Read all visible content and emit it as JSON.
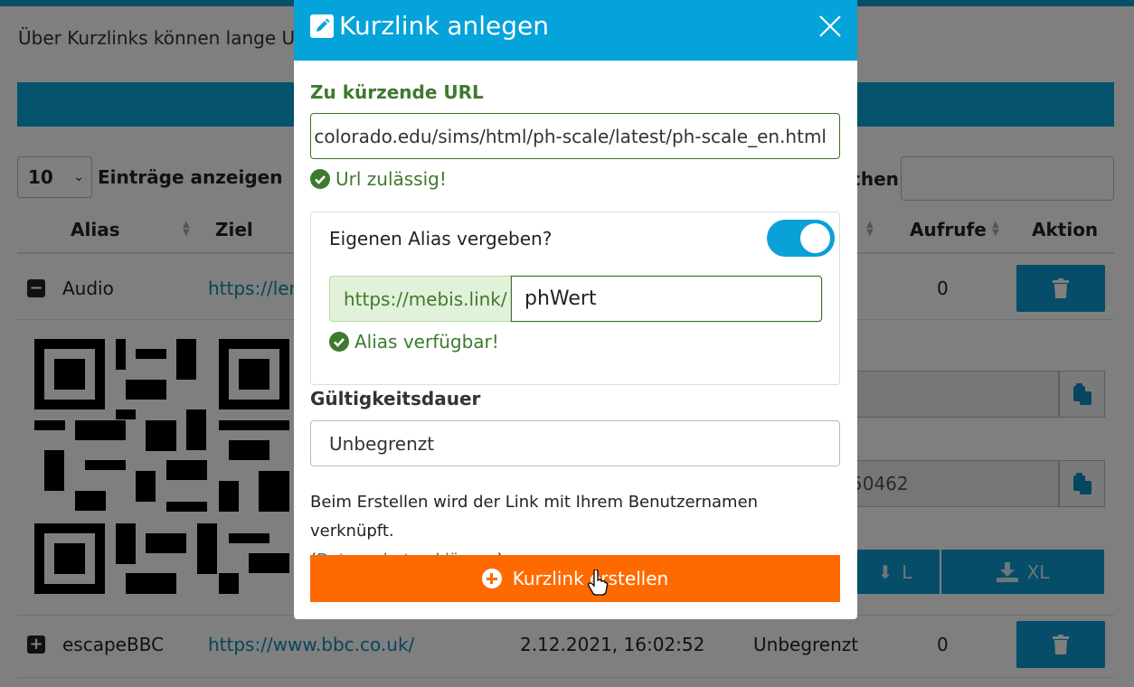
{
  "page": {
    "intro": "Über Kurzlinks können lange URL",
    "length_select": "10",
    "length_label": "Einträge anzeigen",
    "search_label": "chen",
    "columns": [
      {
        "label": "Alias"
      },
      {
        "label": "Ziel"
      },
      {
        "label": "Aufrufe"
      },
      {
        "label": "Aktion"
      }
    ],
    "rows": [
      {
        "alias": "Audio",
        "target": "https://ler",
        "created": "",
        "validity": "",
        "calls": "0",
        "expanded": true
      },
      {
        "alias": "escapeBBC",
        "target": "https://www.bbc.co.uk/",
        "created": "2.12.2021, 16:02:52",
        "validity": "Unbegrenzt",
        "calls": "0",
        "expanded": false
      }
    ],
    "detail": {
      "copy_field_1": "",
      "copy_field_2": "50462",
      "download_buttons": [
        {
          "label": "L",
          "icon": "download-icon"
        },
        {
          "label": "XL",
          "icon": "download-icon"
        }
      ]
    }
  },
  "modal": {
    "title": "Kurzlink anlegen",
    "title_icon": "edit-icon",
    "url_label": "Zu kürzende URL",
    "url_value": "colorado.edu/sims/html/ph-scale/latest/ph-scale_en.html",
    "url_ok": "Url zulässig!",
    "alias_question": "Eigenen Alias vergeben?",
    "alias_toggle_on": true,
    "alias_prefix": "https://mebis.link/",
    "alias_value": "phWert",
    "alias_ok": "Alias verfügbar!",
    "validity_label": "Gültigkeitsdauer",
    "validity_value": "Unbegrenzt",
    "notice_text": "Beim Erstellen wird der Link mit Ihrem Benutzernamen verknüpft.",
    "notice_open": "(",
    "notice_link": "Datenschutzerklärung",
    "notice_close": ")",
    "create_label": "Kurzlink erstellen"
  },
  "colors": {
    "header_blue": "#04a3d9",
    "success_green": "#3d7a2e",
    "create_orange": "#ff6a00",
    "link_blue": "#0e8ab5"
  }
}
